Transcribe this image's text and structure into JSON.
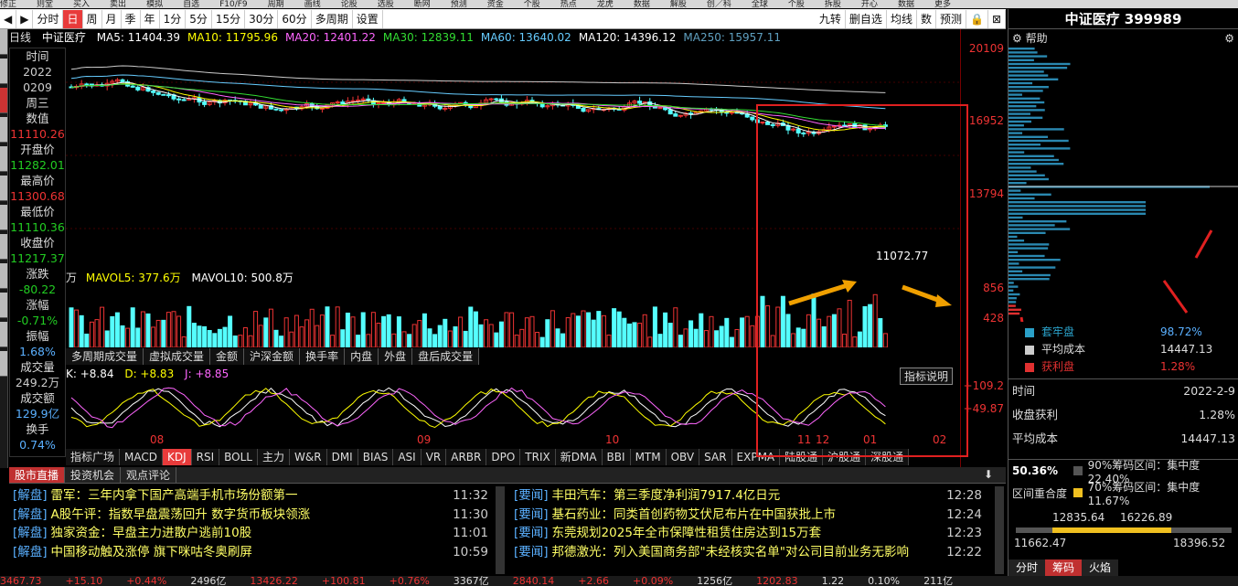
{
  "menubar": {
    "items": [
      "修正",
      "则堂",
      "买入",
      "卖出",
      "模拟",
      "自选",
      "F10/F9",
      "周期",
      "画线",
      "论股",
      "选股",
      "断网",
      "预测",
      "资金",
      "个股",
      "热点",
      "龙虎",
      "数据",
      "解股",
      "创／科",
      "全球",
      "个股",
      "拆股",
      "开心",
      "数据",
      "更多"
    ]
  },
  "toolbar": {
    "tabs": [
      "分时",
      "日",
      "周",
      "月",
      "季",
      "年",
      "1分",
      "5分",
      "15分",
      "30分",
      "60分",
      "多周期",
      "设置"
    ],
    "active": "日",
    "right": [
      "九转",
      "删自选",
      "均线",
      "数",
      "预测"
    ]
  },
  "security": {
    "type_label": "日线",
    "name": "中证医疗",
    "code": "399989"
  },
  "ma": [
    {
      "label": "MA5: 11404.39",
      "color": "#ffffff"
    },
    {
      "label": "MA10: 11795.96",
      "color": "#ffff00"
    },
    {
      "label": "MA20: 12401.22",
      "color": "#ff66ff"
    },
    {
      "label": "MA30: 12839.11",
      "color": "#33dd33"
    },
    {
      "label": "MA60: 13640.02",
      "color": "#66ccff"
    },
    {
      "label": "MA120: 14396.12",
      "color": "#ffffff"
    },
    {
      "label": "MA250: 15957.11",
      "color": "#5fa0c0"
    }
  ],
  "info": {
    "rows": [
      {
        "label": "时间",
        "value": "2022",
        "vc": "#ccc"
      },
      {
        "label": "",
        "value": "0209",
        "vc": "#ccc"
      },
      {
        "label": "周三",
        "value": "",
        "vc": "#ccc"
      },
      {
        "label": "数值",
        "value": "11110.26",
        "vc": "#e33"
      },
      {
        "label": "开盘价",
        "value": "11282.01",
        "vc": "#22cc22"
      },
      {
        "label": "最高价",
        "value": "11300.68",
        "vc": "#e33"
      },
      {
        "label": "最低价",
        "value": "11110.36",
        "vc": "#22cc22"
      },
      {
        "label": "收盘价",
        "value": "11217.37",
        "vc": "#22cc22"
      },
      {
        "label": "涨跌",
        "value": "-80.22",
        "vc": "#22cc22"
      },
      {
        "label": "涨幅",
        "value": "-0.71%",
        "vc": "#22cc22"
      },
      {
        "label": "振幅",
        "value": "1.68%",
        "vc": "#5ab0ff"
      },
      {
        "label": "成交量",
        "value": "249.2万",
        "vc": "#ccc"
      },
      {
        "label": "成交额",
        "value": "129.9亿",
        "vc": "#5ab0ff"
      },
      {
        "label": "换手",
        "value": "0.74%",
        "vc": "#5ab0ff"
      }
    ]
  },
  "price_axis": [
    "20109",
    "16952",
    "13794"
  ],
  "low_label": "11072.77",
  "volume": {
    "v1": "万",
    "mavol5": "MAVOL5: 377.6万",
    "mavol10": "MAVOL10: 500.8万",
    "axis": [
      "856",
      "428"
    ]
  },
  "subtabs": [
    "多周期成交量",
    "虚拟成交量",
    "金额",
    "沪深金额",
    "换手率",
    "内盘",
    "外盘",
    "盘后成交量"
  ],
  "kdj": {
    "k": "K: +8.84",
    "d": "D: +8.83",
    "j": "J: +8.85",
    "axis": [
      "+109.2",
      "+49.87"
    ],
    "explain": "指标说明"
  },
  "xaxis": [
    "08",
    "09",
    "10",
    "11",
    "12",
    "01",
    "02"
  ],
  "indicator_tabs": [
    "指标广场",
    "MACD",
    "KDJ",
    "RSI",
    "BOLL",
    "主力",
    "W&R",
    "DMI",
    "BIAS",
    "ASI",
    "VR",
    "ARBR",
    "DPO",
    "TRIX",
    "新DMA",
    "BBI",
    "MTM",
    "OBV",
    "SAR",
    "EXPMA",
    "陆股通",
    "沪股通",
    "深股通"
  ],
  "indicator_active": "KDJ",
  "news_tabs": [
    "股市直播",
    "投资机会",
    "观点评论"
  ],
  "news_left": [
    {
      "tag": "[解盘]",
      "title": "雷军：三年内拿下国产高端手机市场份额第一",
      "time": "11:32"
    },
    {
      "tag": "[解盘]",
      "title": "A股午评：指数早盘震荡回升 数字货币板块领涨",
      "time": "11:30"
    },
    {
      "tag": "[解盘]",
      "title": "独家资金：早盘主力进散户逃前10股",
      "time": "11:01"
    },
    {
      "tag": "[解盘]",
      "title": "中国移动触及涨停 旗下咪咕冬奥刷屏",
      "time": "10:59"
    }
  ],
  "news_right": [
    {
      "tag": "[要闻]",
      "title": "丰田汽车：第三季度净利润7917.4亿日元",
      "time": "12:28"
    },
    {
      "tag": "[要闻]",
      "title": "基石药业：同类首创药物艾伏尼布片在中国获批上市",
      "time": "12:24"
    },
    {
      "tag": "[要闻]",
      "title": "东莞规划2025年全市保障性租赁住房达到15万套",
      "time": "12:23"
    },
    {
      "tag": "[要闻]",
      "title": "邦德激光：列入美国商务部\"未经核实名单\"对公司目前业务无影响",
      "time": "12:22"
    }
  ],
  "status": [
    "3467.73",
    "+15.10",
    "+0.44%",
    "2496亿",
    "13426.22",
    "+100.81",
    "+0.76%",
    "3367亿",
    "2840.14",
    "+2.66",
    "+0.09%",
    "1256亿",
    "1202.83",
    "1.22",
    "0.10%",
    "211亿"
  ],
  "right_panel": {
    "title": "中证医疗 399989",
    "help": "帮助",
    "legend": [
      {
        "label": "套牢盘",
        "value": "98.72%",
        "color": "#2aa0c8",
        "vc": "#5ab0ff"
      },
      {
        "label": "平均成本",
        "value": "14447.13",
        "color": "#cccccc",
        "vc": "#ddd"
      },
      {
        "label": "获利盘",
        "value": "1.28%",
        "color": "#e03030",
        "vc": "#e33"
      }
    ],
    "stats": [
      {
        "label": "时间",
        "value": "2022-2-9"
      },
      {
        "label": "收盘获利",
        "value": "1.28%"
      },
      {
        "label": "平均成本",
        "value": "14447.13"
      }
    ],
    "concentration": {
      "pct": "50.36%",
      "c90": "90%筹码区间：集中度22.40%",
      "c70": "70%筹码区间：集中度11.67%",
      "overlap": "区间重合度"
    },
    "range_top": [
      "12835.64",
      "16226.89"
    ],
    "range_bottom": [
      "11662.47",
      "18396.52"
    ],
    "tabs": [
      "分时",
      "筹码",
      "火焰"
    ],
    "active_tab": "筹码"
  }
}
